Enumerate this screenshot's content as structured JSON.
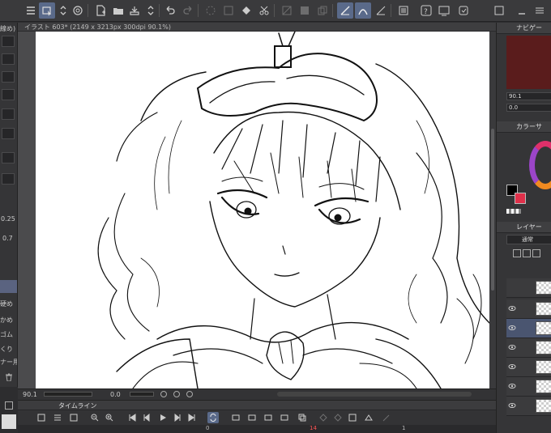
{
  "document_tab": {
    "title": "イラスト 603* (2149 x 3213px 300dpi 90.1%)"
  },
  "left_panel": {
    "item_labels": [
      "線め)",
      "硬め",
      "かめ",
      "ゴム",
      "くり",
      "ナー用"
    ],
    "values": [
      "0.25",
      "0.7"
    ]
  },
  "navigator": {
    "zoom": "90.1",
    "rotation": "0.0"
  },
  "right_panel": {
    "navigator_title": "ナビゲー",
    "zoom_value": "90.1",
    "angle_value": "0.0",
    "color_title": "カラーサ",
    "layer_title": "レイヤー",
    "blend_mode": "通常"
  },
  "timeline": {
    "title": "タイムライン",
    "ruler": [
      "0",
      "14",
      "1"
    ]
  },
  "colors": {
    "accent": "#5a6a8a",
    "main_color": "#000000",
    "sub_color": "#e0304a"
  }
}
